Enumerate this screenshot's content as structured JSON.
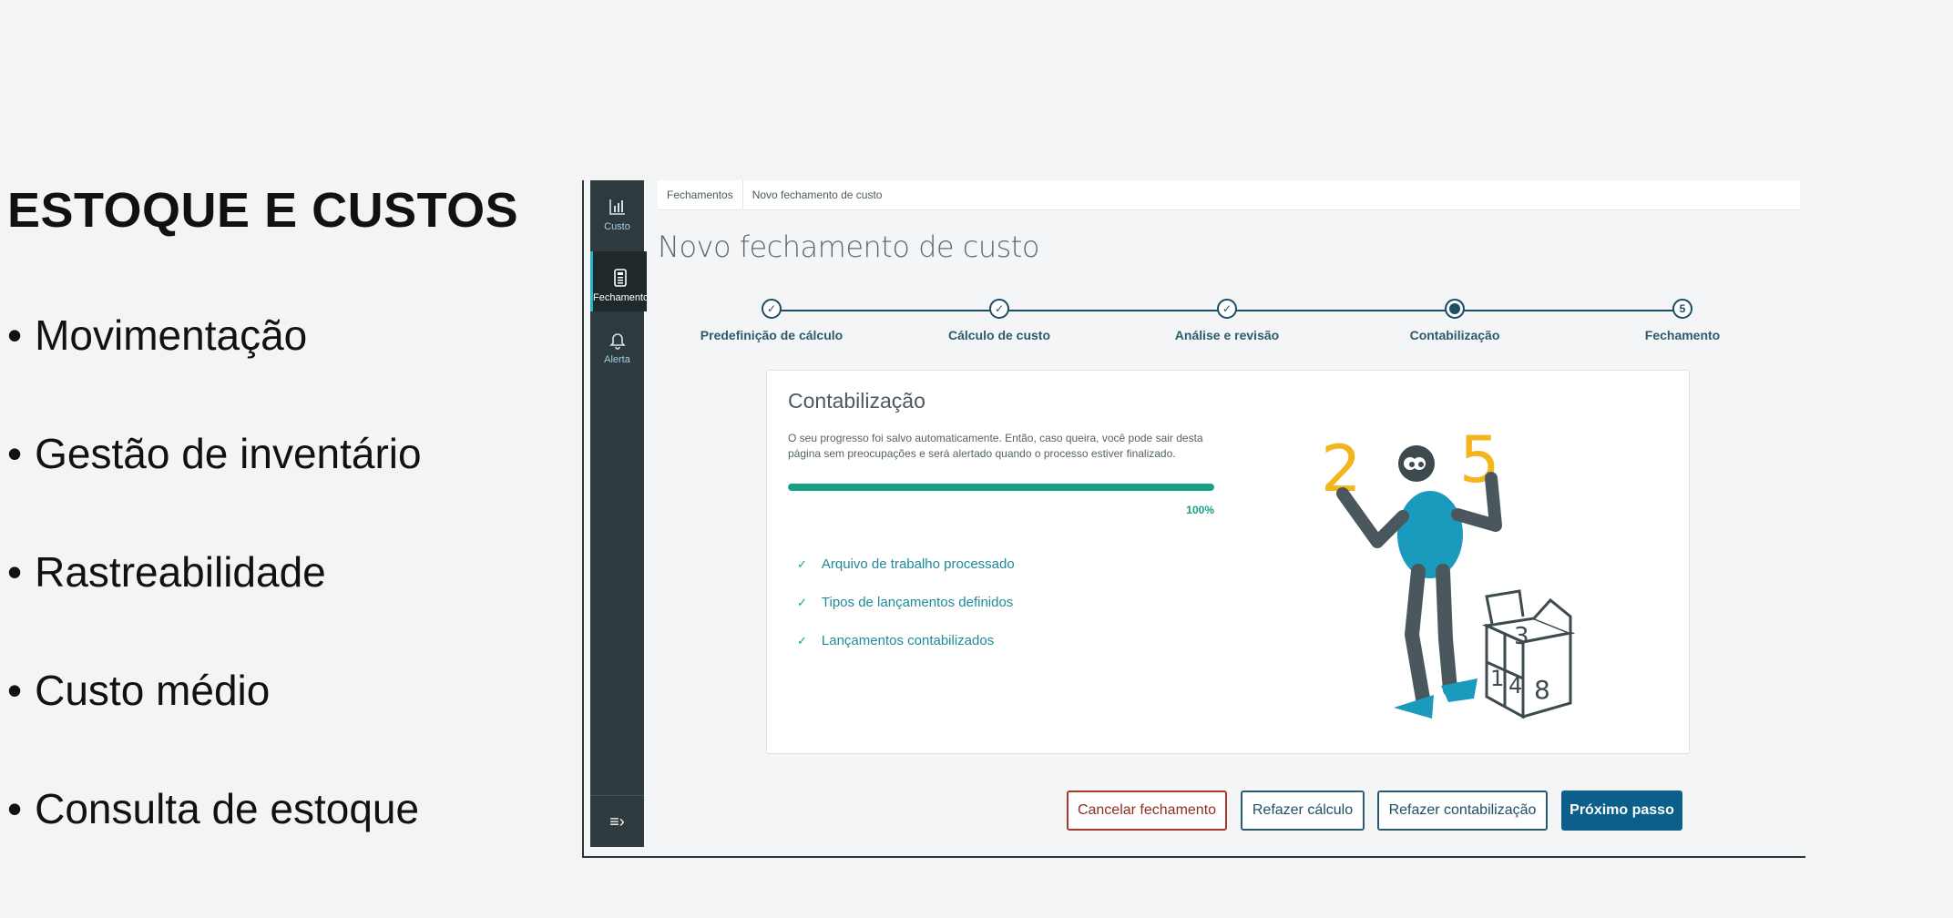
{
  "slide": {
    "title": "ESTOQUE E CUSTOS",
    "bullets": [
      "Movimentação",
      "Gestão de inventário",
      "Rastreabilidade",
      "Custo médio",
      "Consulta de estoque"
    ]
  },
  "sidebar": {
    "items": [
      {
        "label": "Custo",
        "icon": "bar-chart-icon"
      },
      {
        "label": "Fechamento",
        "icon": "calculator-icon",
        "active": true
      },
      {
        "label": "Alerta",
        "icon": "bell-icon"
      }
    ],
    "collapse_icon": "collapse-menu-icon"
  },
  "breadcrumb": [
    "Fechamentos",
    "Novo fechamento de custo"
  ],
  "page_title": "Novo fechamento de custo",
  "stepper": {
    "steps": [
      {
        "label": "Predefinição de cálculo",
        "state": "done"
      },
      {
        "label": "Cálculo de custo",
        "state": "done"
      },
      {
        "label": "Análise e revisão",
        "state": "done"
      },
      {
        "label": "Contabilização",
        "state": "current"
      },
      {
        "label": "Fechamento",
        "state": "pending",
        "number": "5"
      }
    ]
  },
  "card": {
    "title": "Contabilização",
    "description": "O seu progresso foi salvo automaticamente. Então, caso queira, você pode sair desta página sem preocupações e será alertado quando o processo estiver finalizado.",
    "progress_value": 100,
    "progress_label": "100%",
    "checks": [
      "Arquivo de trabalho processado",
      "Tipos de lançamentos definidos",
      "Lançamentos contabilizados"
    ],
    "illustration": {
      "left_number": "2",
      "right_number": "5",
      "box_numbers": [
        "3",
        "1",
        "4",
        "8"
      ]
    }
  },
  "buttons": {
    "cancel": "Cancelar fechamento",
    "recalc": "Refazer cálculo",
    "reaccount": "Refazer contabilização",
    "next": "Próximo passo"
  },
  "colors": {
    "accent": "#0b5f8a",
    "success": "#16a085",
    "sidebar": "#2f3a3e",
    "cancel": "#a33a2a"
  }
}
